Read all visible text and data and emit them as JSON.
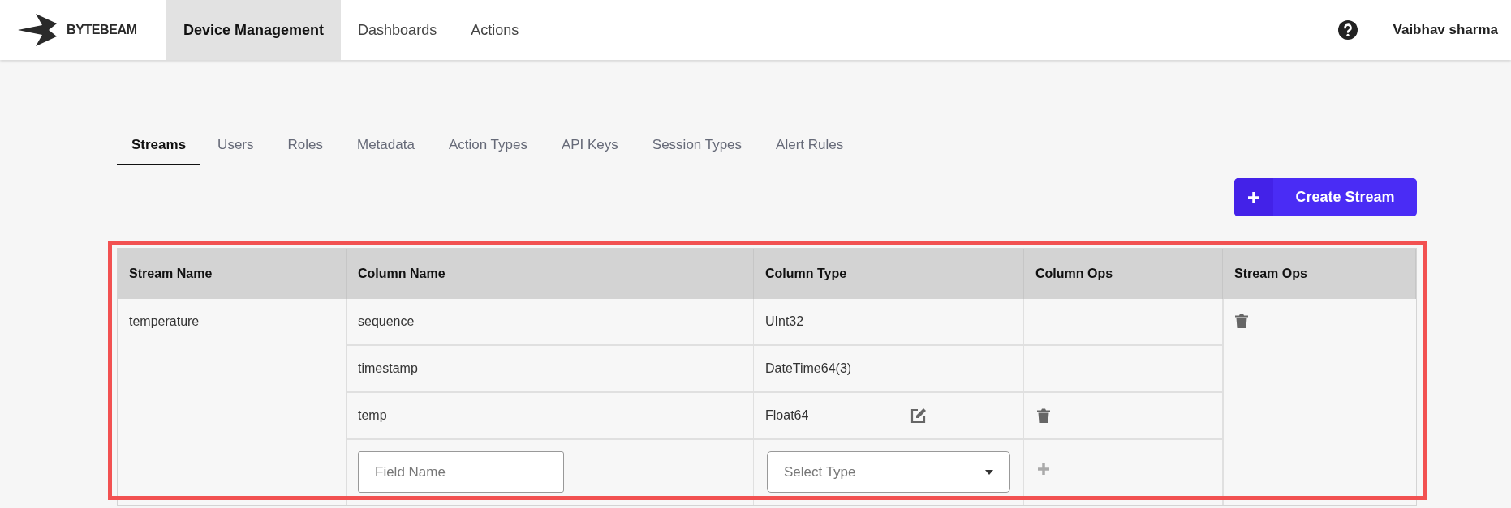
{
  "brand": {
    "name": "BYTEBEAM"
  },
  "nav": [
    {
      "label": "Device Management",
      "selected": true
    },
    {
      "label": "Dashboards",
      "selected": false
    },
    {
      "label": "Actions",
      "selected": false
    }
  ],
  "user": {
    "name": "Vaibhav sharma"
  },
  "tabs": [
    {
      "label": "Streams",
      "selected": true
    },
    {
      "label": "Users",
      "selected": false
    },
    {
      "label": "Roles",
      "selected": false
    },
    {
      "label": "Metadata",
      "selected": false
    },
    {
      "label": "Action Types",
      "selected": false
    },
    {
      "label": "API Keys",
      "selected": false
    },
    {
      "label": "Session Types",
      "selected": false
    },
    {
      "label": "Alert Rules",
      "selected": false
    }
  ],
  "create_button": {
    "label": "Create Stream"
  },
  "highlight_frame": true,
  "table": {
    "columns": [
      "Stream Name",
      "Column Name",
      "Column Type",
      "Column Ops",
      "Stream Ops"
    ],
    "rows": [
      {
        "stream_name": "temperature",
        "deletable": true,
        "fields": [
          {
            "name": "sequence",
            "type": "UInt32",
            "editable": false,
            "deletable": false
          },
          {
            "name": "timestamp",
            "type": "DateTime64(3)",
            "editable": false,
            "deletable": false
          },
          {
            "name": "temp",
            "type": "Float64",
            "editable": true,
            "deletable": true
          }
        ],
        "new_field": {
          "name_placeholder": "Field Name",
          "type_placeholder": "Select Type"
        }
      }
    ]
  }
}
